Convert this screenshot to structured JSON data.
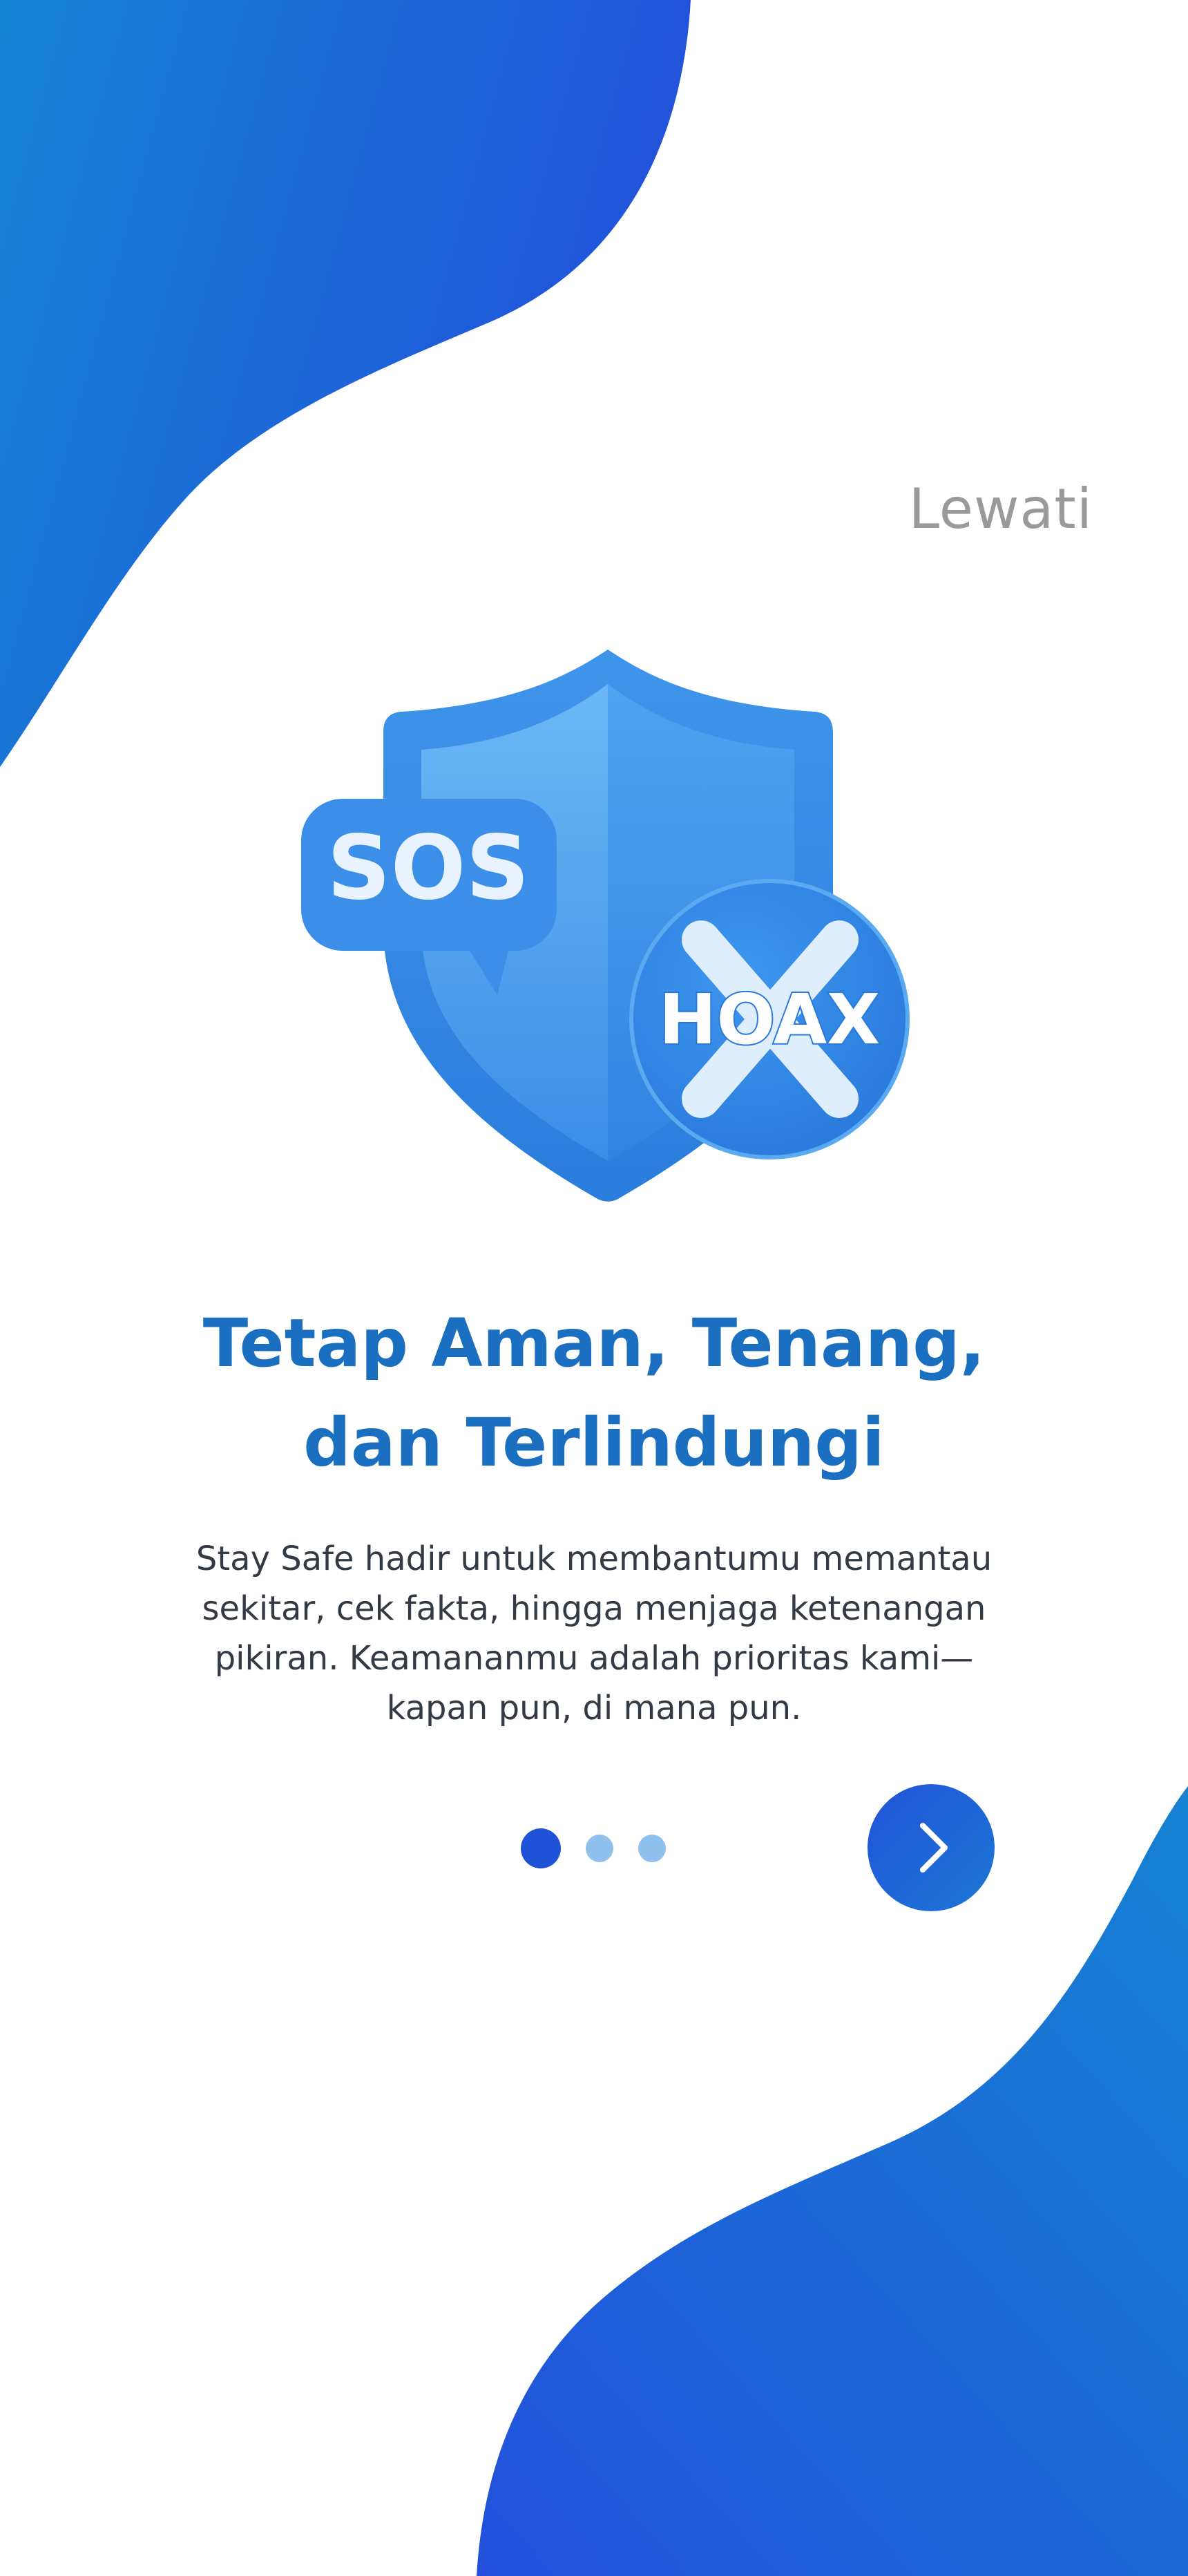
{
  "onboarding": {
    "skip_label": "Lewati",
    "title_lines": [
      "Tetap Aman, Tenang,",
      "dan Terlindungi"
    ],
    "description_lines": [
      "Stay Safe hadir untuk membantumu memantau",
      "sekitar, cek fakta, hingga menjaga ketenangan",
      "pikiran. Keamananmu adalah prioritas kami—",
      "kapan pun, di mana pun."
    ],
    "illustration": {
      "sos_label": "SOS",
      "hoax_label": "HOAX"
    },
    "pagination": {
      "total": 3,
      "active": 1
    },
    "next_icon": "chevron-right-icon"
  },
  "colors": {
    "accent": "#1a6fc0",
    "blob_dark": "#2052d8",
    "blob_light": "#1582d2",
    "dot_active": "#2052d8",
    "dot_inactive": "#8ec1ee",
    "skip_text": "#9a9a9a"
  }
}
